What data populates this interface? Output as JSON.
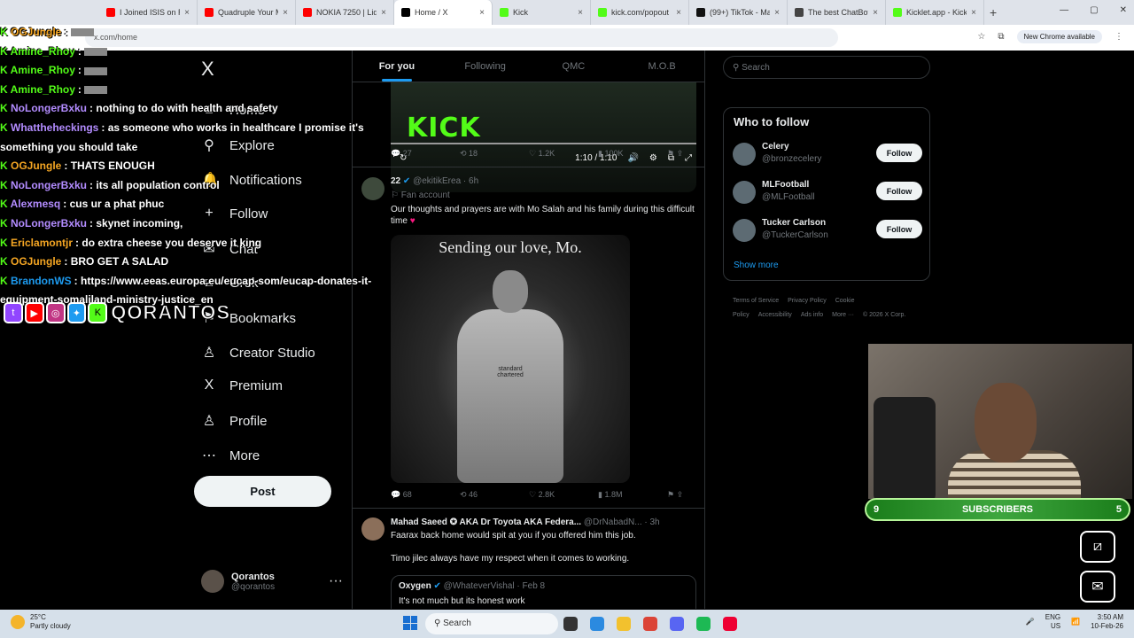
{
  "browser": {
    "tabs": [
      {
        "title": "I Joined ISIS on Ro",
        "color": "#ff0000"
      },
      {
        "title": "Quadruple Your M",
        "color": "#ff0000"
      },
      {
        "title": "NOKIA 7250 | Liqu",
        "color": "#ff0000"
      },
      {
        "title": "Home / X",
        "color": "#000000",
        "active": true
      },
      {
        "title": "Kick",
        "color": "#53fc18"
      },
      {
        "title": "kick.com/popout",
        "color": "#53fc18"
      },
      {
        "title": "(99+) TikTok - Mal",
        "color": "#111111"
      },
      {
        "title": "The best ChatBot",
        "color": "#444444"
      },
      {
        "title": "Kicklet.app - Kick",
        "color": "#53fc18"
      }
    ],
    "close_glyph": "×",
    "new_tab": "+",
    "url": "x.com/home",
    "new_chrome": "New Chrome available"
  },
  "x": {
    "logo": "X",
    "nav": [
      {
        "label": "Home",
        "icon": "⌂",
        "name": "home"
      },
      {
        "label": "Explore",
        "icon": "⚲",
        "name": "explore"
      },
      {
        "label": "Notifications",
        "icon": "🔔",
        "name": "notifications"
      },
      {
        "label": "Follow",
        "icon": "+",
        "name": "follow"
      },
      {
        "label": "Chat",
        "icon": "✉",
        "name": "chat"
      },
      {
        "label": "Grok",
        "icon": "⧄",
        "name": "grok"
      },
      {
        "label": "Bookmarks",
        "icon": "⚑",
        "name": "bookmarks"
      },
      {
        "label": "Creator Studio",
        "icon": "♙",
        "name": "creator-studio"
      },
      {
        "label": "Premium",
        "icon": "X",
        "name": "premium"
      },
      {
        "label": "Profile",
        "icon": "♙",
        "name": "profile"
      },
      {
        "label": "More",
        "icon": "⋯",
        "name": "more"
      }
    ],
    "post_label": "Post",
    "account": {
      "name": "Qorantos",
      "handle": "@qorantos",
      "menu": "···"
    },
    "feed_tabs": [
      "For you",
      "Following",
      "QMC",
      "M.O.B"
    ],
    "video": {
      "brand": "KICK",
      "time": "1:10 / 1:10"
    },
    "post1_actions": {
      "replies": "27",
      "reposts": "18",
      "likes": "1.2K",
      "views": "100K"
    },
    "post2": {
      "name": "22",
      "handle": "@ekitikErea",
      "time": "6h",
      "badge": "Fan account",
      "text": "Our thoughts and prayers are with Mo Salah and his family during this difficult time",
      "image_caption": "Sending our love, Mo.",
      "sponsor": "standard chartered",
      "actions": {
        "replies": "68",
        "reposts": "46",
        "likes": "2.8K",
        "views": "1.8M"
      }
    },
    "post3": {
      "name": "Mahad Saeed ✪ AKA Dr Toyota AKA Federa...",
      "handle": "@DrNabadN...",
      "time": "3h",
      "line1": "Faarax back home would spit at you if you offered him this job.",
      "line2": "Timo jilec always have my respect when it comes to working.",
      "quote_name": "Oxygen",
      "quote_handle": "@WhateverVishal",
      "quote_time": "Feb 8",
      "quote_text": "It's not much but its honest work"
    },
    "search_placeholder": "Search",
    "show_more_top": "Show more",
    "who_to_follow": {
      "title": "Who to follow",
      "accounts": [
        {
          "name": "Celery",
          "handle": "@bronzecelery"
        },
        {
          "name": "MLFootball",
          "handle": "@MLFootball"
        },
        {
          "name": "Tucker Carlson",
          "handle": "@TuckerCarlson"
        }
      ],
      "follow_label": "Follow",
      "show_more": "Show more"
    },
    "footer": [
      "Terms of Service",
      "Privacy Policy",
      "Cookie Policy",
      "Accessibility",
      "Ads info",
      "More ···",
      "© 2026 X Corp."
    ]
  },
  "overlay": {
    "chat": [
      {
        "user": "OGJungle",
        "msg": "",
        "color": "#f5a623"
      },
      {
        "user": "Amine_Rhoy",
        "msg": "",
        "color": "#53fc18"
      },
      {
        "user": "Amine_Rhoy",
        "msg": "",
        "color": "#53fc18"
      },
      {
        "user": "Amine_Rhoy",
        "msg": "",
        "color": "#53fc18"
      },
      {
        "user": "NoLongerBxku",
        "msg": "nothing to do with health and safety",
        "color": "#b38cff"
      },
      {
        "user": "Whattheheckings",
        "msg": "as someone who works in healthcare I promise it's something you should take",
        "color": "#b38cff"
      },
      {
        "user": "OGJungle",
        "msg": "THATS ENOUGH",
        "color": "#f5a623"
      },
      {
        "user": "NoLongerBxku",
        "msg": "its all population control",
        "color": "#b38cff"
      },
      {
        "user": "Alexmesq",
        "msg": "cus ur a phat phuc",
        "color": "#b38cff"
      },
      {
        "user": "NoLongerBxku",
        "msg": "skynet incoming,",
        "color": "#b38cff"
      },
      {
        "user": "Ericlamontjr",
        "msg": "do extra cheese you deserve it king",
        "color": "#f5a623"
      },
      {
        "user": "OGJungle",
        "msg": "BRO GET A SALAD",
        "color": "#f5a623"
      },
      {
        "user": "BrandonWS",
        "msg": "https://www.eeas.europa.eu/eucap-som/eucap-donates-it-equipment-somaliland-ministry-justice_en",
        "color": "#1d9bf0"
      }
    ],
    "brand_name": "QORANTOS",
    "subscribers": {
      "left": "9",
      "label": "SUBSCRIBERS",
      "right": "5"
    }
  },
  "taskbar": {
    "temp": "25°C",
    "weather": "Partly cloudy",
    "search": "Search",
    "lang1": "ENG",
    "lang2": "US",
    "time": "3:50 AM",
    "date": "10-Feb-26"
  }
}
